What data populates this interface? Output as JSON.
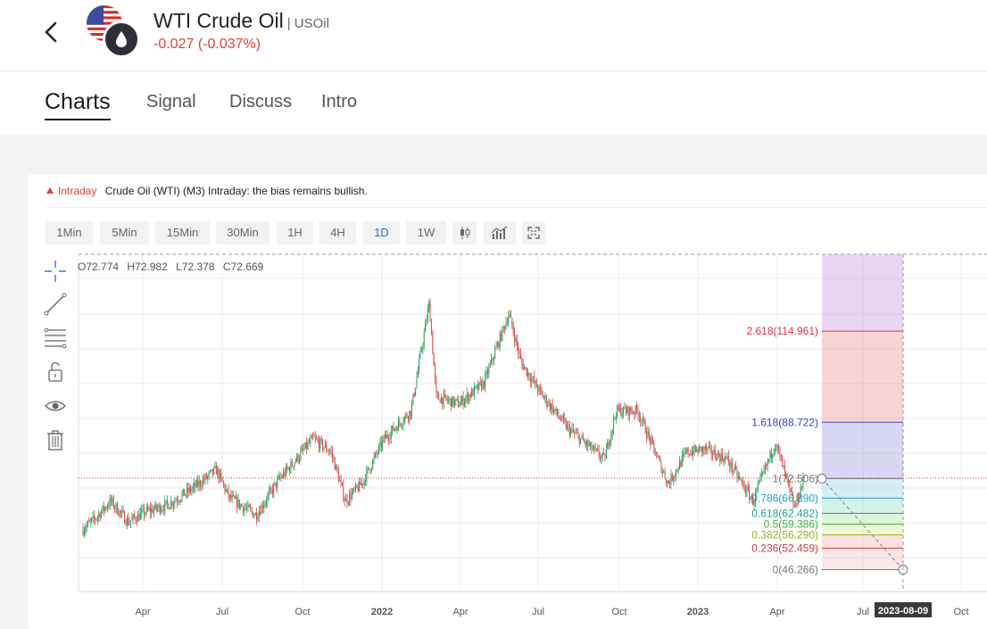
{
  "header": {
    "title": "WTI Crude Oil",
    "symbol": "| USOil",
    "change": "-0.027 (-0.037%)",
    "back_icon": "chevron-left-icon",
    "flag_icon": "us-flag-icon",
    "badge_icon": "oil-drop-icon"
  },
  "tabs": [
    {
      "label": "Charts",
      "active": true
    },
    {
      "label": "Signal",
      "active": false
    },
    {
      "label": "Discuss",
      "active": false
    },
    {
      "label": "Intro",
      "active": false
    }
  ],
  "signal": {
    "tag": "Intraday",
    "text": "Crude Oil (WTI) (M3) Intraday: the bias remains bullish."
  },
  "timeframes": [
    "1Min",
    "5Min",
    "15Min",
    "30Min",
    "1H",
    "4H",
    "1D",
    "1W"
  ],
  "active_timeframe": "1D",
  "toolbar_icons": [
    "candlestick-icon",
    "indicator-icon",
    "fullscreen-icon"
  ],
  "drawing_tools": [
    "crosshair-icon",
    "trendline-icon",
    "fib-lines-icon",
    "lock-icon",
    "eye-icon",
    "trash-icon"
  ],
  "ohlc": {
    "O": "72.774",
    "H": "72.982",
    "L": "72.378",
    "C": "72.669"
  },
  "chart_data": {
    "type": "candlestick",
    "x_ticks": [
      "Apr",
      "Jul",
      "Oct",
      "2022",
      "Apr",
      "Jul",
      "Oct",
      "2023",
      "Apr",
      "Jul",
      "Oct"
    ],
    "cursor_date": "2023-08-09",
    "current_price": 72.669,
    "fib_levels": [
      {
        "label": "2.618(114.961)",
        "ratio": 2.618,
        "value": 114.961,
        "color": "#d9333f"
      },
      {
        "label": "1.618(88.722)",
        "ratio": 1.618,
        "value": 88.722,
        "color": "#3e3ec8"
      },
      {
        "label": "1(72.506)",
        "ratio": 1,
        "value": 72.506,
        "color": "#777777"
      },
      {
        "label": "0.786(66.890)",
        "ratio": 0.786,
        "value": 66.89,
        "color": "#1f9ed0"
      },
      {
        "label": "0.618(62.482)",
        "ratio": 0.618,
        "value": 62.482,
        "color": "#18a58c"
      },
      {
        "label": "0.5(59.386)",
        "ratio": 0.5,
        "value": 59.386,
        "color": "#3fb53f"
      },
      {
        "label": "0.382(56.290)",
        "ratio": 0.382,
        "value": 56.29,
        "color": "#98b416"
      },
      {
        "label": "0.236(52.459)",
        "ratio": 0.236,
        "value": 52.459,
        "color": "#d9333f"
      },
      {
        "label": "0(46.266)",
        "ratio": 0,
        "value": 46.266,
        "color": "#777777"
      }
    ],
    "price_path": [
      [
        "2021-02-01",
        58
      ],
      [
        "2021-02-15",
        61
      ],
      [
        "2021-03-05",
        66
      ],
      [
        "2021-03-25",
        60
      ],
      [
        "2021-04-15",
        63
      ],
      [
        "2021-05-10",
        65
      ],
      [
        "2021-06-10",
        70
      ],
      [
        "2021-07-05",
        75
      ],
      [
        "2021-07-20",
        67
      ],
      [
        "2021-08-20",
        62
      ],
      [
        "2021-09-15",
        72
      ],
      [
        "2021-10-25",
        84
      ],
      [
        "2021-11-15",
        80
      ],
      [
        "2021-12-01",
        66
      ],
      [
        "2021-12-20",
        71
      ],
      [
        "2022-01-15",
        84
      ],
      [
        "2022-02-15",
        92
      ],
      [
        "2022-03-08",
        123
      ],
      [
        "2022-03-16",
        96
      ],
      [
        "2022-04-11",
        94
      ],
      [
        "2022-05-10",
        100
      ],
      [
        "2022-06-08",
        120
      ],
      [
        "2022-06-22",
        106
      ],
      [
        "2022-07-15",
        97
      ],
      [
        "2022-08-15",
        87
      ],
      [
        "2022-09-26",
        78
      ],
      [
        "2022-10-10",
        92
      ],
      [
        "2022-11-04",
        92
      ],
      [
        "2022-12-09",
        71
      ],
      [
        "2022-12-30",
        80
      ],
      [
        "2023-01-20",
        81
      ],
      [
        "2023-02-15",
        78
      ],
      [
        "2023-03-17",
        66
      ],
      [
        "2023-04-12",
        83
      ],
      [
        "2023-05-04",
        64
      ],
      [
        "2023-05-15",
        72.669
      ]
    ]
  }
}
